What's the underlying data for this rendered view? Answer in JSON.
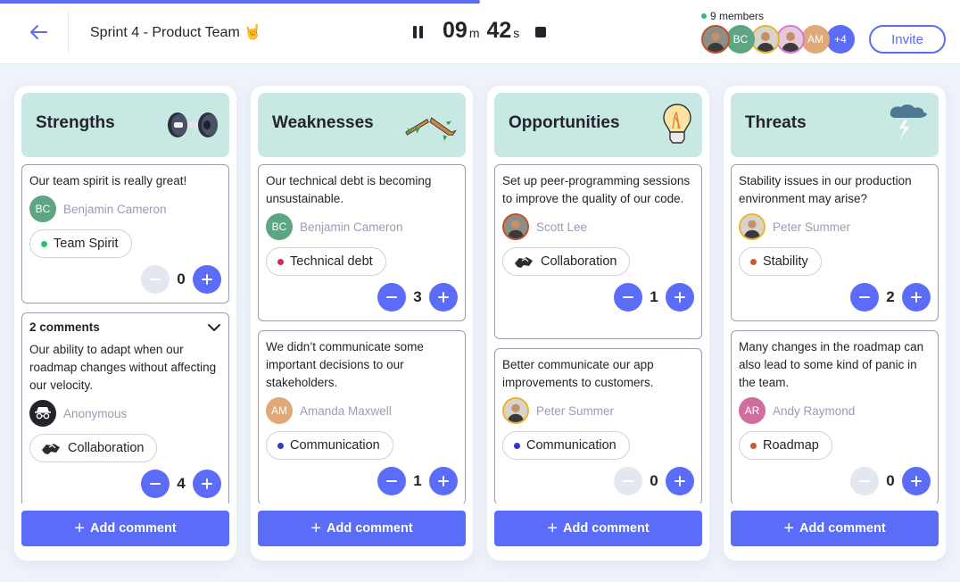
{
  "header": {
    "back_icon": "arrow-left-icon",
    "title": "Sprint 4 - Product Team 🤘",
    "progress_fraction": 0.5,
    "timer": {
      "minutes": "09",
      "minutes_unit": "m",
      "seconds": "42",
      "seconds_unit": "s",
      "pause_icon": "pause-icon",
      "stop_icon": "stop-icon"
    },
    "members_label": "9 members",
    "avatars": [
      {
        "type": "photo",
        "name": "Scott Lee",
        "ring": "#c2502a",
        "bg": "#8c8f86"
      },
      {
        "type": "initials",
        "initials": "BC",
        "bg": "#5da583"
      },
      {
        "type": "photo",
        "name": "Peter Summer",
        "ring": "#e9b52b",
        "bg": "#d8d4cc"
      },
      {
        "type": "photo",
        "name": "Member",
        "ring": "#d479d1",
        "bg": "#e6c9de"
      },
      {
        "type": "initials",
        "initials": "AM",
        "bg": "#e1a878"
      },
      {
        "type": "initials",
        "initials": "+4",
        "bg": "#5a6cf8"
      }
    ],
    "invite_label": "Invite"
  },
  "columns": [
    {
      "title": "Strengths",
      "icon": "dumbbell-icon",
      "add_label": "Add comment",
      "cards": [
        {
          "text": "Our team spirit is really great!",
          "author": "Benjamin Cameron",
          "author_initials": "BC",
          "author_bg": "#5da583",
          "author_type": "initials",
          "tag": "Team Spirit",
          "tag_color": "#2dbd77",
          "tag_icon": "dot",
          "votes": "0",
          "minus_disabled": true
        },
        {
          "comments": "2 comments",
          "text": "Our ability to adapt when our roadmap changes without affecting our velocity.",
          "author": "Anonymous",
          "author_type": "anonymous",
          "author_bg": "#24242c",
          "tag": "Collaboration",
          "tag_icon": "handshake",
          "votes": "4",
          "minus_disabled": false
        }
      ]
    },
    {
      "title": "Weaknesses",
      "icon": "broken-branch-icon",
      "add_label": "Add comment",
      "cards": [
        {
          "text": "Our technical debt is becoming unsustainable.",
          "author": "Benjamin Cameron",
          "author_initials": "BC",
          "author_bg": "#5da583",
          "author_type": "initials",
          "tag": "Technical debt",
          "tag_color": "#cc2c4e",
          "tag_icon": "dot",
          "votes": "3",
          "minus_disabled": false
        },
        {
          "text": "We didn’t communicate some important decisions to our stakeholders.",
          "author": "Amanda Maxwell",
          "author_initials": "AM",
          "author_bg": "#e1a878",
          "author_type": "initials",
          "tag": "Communication",
          "tag_color": "#2a3bc4",
          "tag_icon": "dot",
          "votes": "1",
          "minus_disabled": false
        }
      ]
    },
    {
      "title": "Opportunities",
      "icon": "light-bulb-icon",
      "add_label": "Add comment",
      "cards": [
        {
          "text": "Set up peer-programming sessions to improve the quality of our code.",
          "author": "Scott Lee",
          "author_type": "photo",
          "author_ring": "#c2502a",
          "author_bg": "#8c8f86",
          "tag": "Collaboration",
          "tag_icon": "handshake",
          "votes": "1",
          "minus_disabled": false,
          "extra_space": true
        },
        {
          "text": "Better communicate our app improvements to customers.",
          "author": "Peter Summer",
          "author_type": "photo",
          "author_ring": "#e9b52b",
          "author_bg": "#d8d4cc",
          "tag": "Communication",
          "tag_color": "#2a3bc4",
          "tag_icon": "dot",
          "votes": "0",
          "minus_disabled": true
        }
      ]
    },
    {
      "title": "Threats",
      "icon": "storm-cloud-icon",
      "add_label": "Add comment",
      "cards": [
        {
          "text": "Stability issues in our production environment may arise?",
          "author": "Peter Summer",
          "author_type": "photo",
          "author_ring": "#e9b52b",
          "author_bg": "#d8d4cc",
          "tag": "Stability",
          "tag_color": "#cc5a2a",
          "tag_icon": "dot",
          "votes": "2",
          "minus_disabled": false
        },
        {
          "text": "Many changes in the roadmap can also lead to some kind of panic in the team.",
          "author": "Andy Raymond",
          "author_initials": "AR",
          "author_bg": "#cf6d9f",
          "author_type": "initials",
          "tag": "Roadmap",
          "tag_color": "#cc5a2a",
          "tag_icon": "dot",
          "votes": "0",
          "minus_disabled": true
        }
      ]
    }
  ],
  "colors": {
    "accent": "#5a6cf8",
    "column_header": "#c8e9e3",
    "background": "#eef2f9"
  }
}
